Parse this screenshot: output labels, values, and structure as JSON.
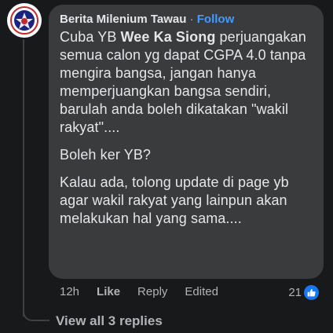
{
  "comment": {
    "author": "Berita Milenium Tawau",
    "separator": "·",
    "follow_label": "Follow",
    "text_prefix": "Cuba YB",
    "mention": "Wee Ka Siong",
    "paragraph1_rest": "perjuangakan semua calon yg dapat CGPA 4.0 tanpa mengira bangsa, jangan hanya memperjuangkan bangsa sendiri, barulah anda boleh dikatakan \"wakil rakyat\"....",
    "paragraph2": "Boleh ker YB?",
    "paragraph3": "Kalau ada, tolong update di page yb agar wakil rakyat yang lainpun akan melakukan hal yang sama...."
  },
  "actions": {
    "time": "12h",
    "like_label": "Like",
    "reply_label": "Reply",
    "edited_label": "Edited"
  },
  "reactions": {
    "count": "21",
    "type_icon": "like-icon"
  },
  "replies": {
    "view_label": "View all 3 replies"
  },
  "colors": {
    "background": "#18191a",
    "bubble": "#3a3b3c",
    "text": "#e4e6eb",
    "secondary_text": "#b0b3b8",
    "follow": "#4599ff",
    "like_blue": "#1877f2"
  }
}
